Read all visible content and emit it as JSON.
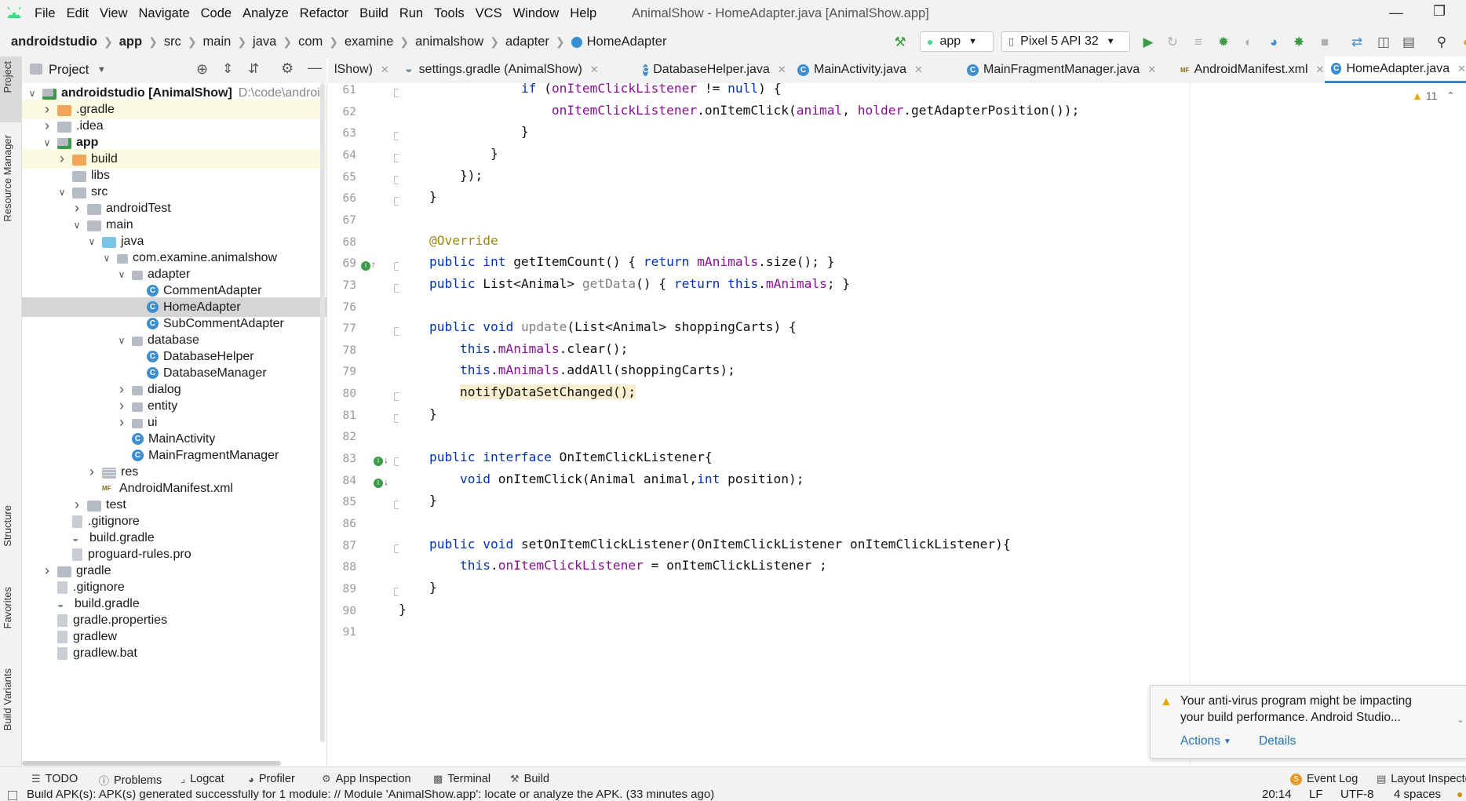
{
  "menubar": {
    "items": [
      "File",
      "Edit",
      "View",
      "Navigate",
      "Code",
      "Analyze",
      "Refactor",
      "Build",
      "Run",
      "Tools",
      "VCS",
      "Window",
      "Help"
    ],
    "window_title": "AnimalShow - HomeAdapter.java [AnimalShow.app]"
  },
  "navbar": {
    "breadcrumbs": [
      "androidstudio",
      "app",
      "src",
      "main",
      "java",
      "com",
      "examine",
      "animalshow",
      "adapter",
      "HomeAdapter"
    ],
    "run_config": "app",
    "device": "Pixel 5 API 32"
  },
  "side_tabs": {
    "left": [
      "Project",
      "Resource Manager",
      "Structure",
      "Favorites",
      "Build Variants"
    ]
  },
  "project_panel": {
    "title": "Project",
    "tree": [
      {
        "label": "androidstudio [AnimalShow]",
        "extra": "D:\\code\\androi",
        "indent": 0,
        "chev": "down",
        "icon": "module-folder",
        "bold": true
      },
      {
        "label": ".gradle",
        "indent": 1,
        "chev": "right",
        "icon": "folder-orange",
        "hl": true
      },
      {
        "label": ".idea",
        "indent": 1,
        "chev": "right",
        "icon": "folder"
      },
      {
        "label": "app",
        "indent": 1,
        "chev": "down",
        "icon": "module-folder",
        "bold": true
      },
      {
        "label": "build",
        "indent": 2,
        "chev": "right",
        "icon": "folder-orange",
        "hl": true
      },
      {
        "label": "libs",
        "indent": 2,
        "chev": "none",
        "icon": "folder"
      },
      {
        "label": "src",
        "indent": 2,
        "chev": "down",
        "icon": "folder"
      },
      {
        "label": "androidTest",
        "indent": 3,
        "chev": "right",
        "icon": "folder"
      },
      {
        "label": "main",
        "indent": 3,
        "chev": "down",
        "icon": "folder"
      },
      {
        "label": "java",
        "indent": 4,
        "chev": "down",
        "icon": "folder-blue"
      },
      {
        "label": "com.examine.animalshow",
        "indent": 5,
        "chev": "down",
        "icon": "package"
      },
      {
        "label": "adapter",
        "indent": 6,
        "chev": "down",
        "icon": "package"
      },
      {
        "label": "CommentAdapter",
        "indent": 7,
        "chev": "none",
        "icon": "class"
      },
      {
        "label": "HomeAdapter",
        "indent": 7,
        "chev": "none",
        "icon": "class",
        "sel": true
      },
      {
        "label": "SubCommentAdapter",
        "indent": 7,
        "chev": "none",
        "icon": "class"
      },
      {
        "label": "database",
        "indent": 6,
        "chev": "down",
        "icon": "package"
      },
      {
        "label": "DatabaseHelper",
        "indent": 7,
        "chev": "none",
        "icon": "class"
      },
      {
        "label": "DatabaseManager",
        "indent": 7,
        "chev": "none",
        "icon": "class"
      },
      {
        "label": "dialog",
        "indent": 6,
        "chev": "right",
        "icon": "package"
      },
      {
        "label": "entity",
        "indent": 6,
        "chev": "right",
        "icon": "package"
      },
      {
        "label": "ui",
        "indent": 6,
        "chev": "right",
        "icon": "package"
      },
      {
        "label": "MainActivity",
        "indent": 6,
        "chev": "none",
        "icon": "class"
      },
      {
        "label": "MainFragmentManager",
        "indent": 6,
        "chev": "none",
        "icon": "class"
      },
      {
        "label": "res",
        "indent": 4,
        "chev": "right",
        "icon": "res-folder"
      },
      {
        "label": "AndroidManifest.xml",
        "indent": 4,
        "chev": "none",
        "icon": "manifest"
      },
      {
        "label": "test",
        "indent": 3,
        "chev": "right",
        "icon": "folder"
      },
      {
        "label": ".gitignore",
        "indent": 2,
        "chev": "none",
        "icon": "file"
      },
      {
        "label": "build.gradle",
        "indent": 2,
        "chev": "none",
        "icon": "gradle"
      },
      {
        "label": "proguard-rules.pro",
        "indent": 2,
        "chev": "none",
        "icon": "file"
      },
      {
        "label": "gradle",
        "indent": 1,
        "chev": "right",
        "icon": "folder"
      },
      {
        "label": ".gitignore",
        "indent": 1,
        "chev": "none",
        "icon": "file"
      },
      {
        "label": "build.gradle",
        "indent": 1,
        "chev": "none",
        "icon": "gradle"
      },
      {
        "label": "gradle.properties",
        "indent": 1,
        "chev": "none",
        "icon": "file"
      },
      {
        "label": "gradlew",
        "indent": 1,
        "chev": "none",
        "icon": "file"
      },
      {
        "label": "gradlew.bat",
        "indent": 1,
        "chev": "none",
        "icon": "file"
      }
    ]
  },
  "editor_tabs": [
    {
      "label": "lShow)",
      "icon": "none",
      "active": false
    },
    {
      "label": "settings.gradle (AnimalShow)",
      "icon": "gradle",
      "active": false
    },
    {
      "label": "DatabaseHelper.java",
      "icon": "class",
      "active": false
    },
    {
      "label": "MainActivity.java",
      "icon": "class",
      "active": false
    },
    {
      "label": "MainFragmentManager.java",
      "icon": "class",
      "active": false
    },
    {
      "label": "AndroidManifest.xml",
      "icon": "manifest",
      "active": false
    },
    {
      "label": "HomeAdapter.java",
      "icon": "class",
      "active": true
    }
  ],
  "inspection": {
    "count": "11"
  },
  "code_lines": [
    {
      "n": "61",
      "tokens": [
        [
          "            ",
          ""
        ],
        [
          "if",
          "kw"
        ],
        [
          " (",
          ""
        ],
        [
          "onItemClickListener",
          "fld"
        ],
        [
          " != ",
          ""
        ],
        [
          "null",
          "kw"
        ],
        [
          ") {",
          ""
        ]
      ]
    },
    {
      "n": "62",
      "tokens": [
        [
          "                ",
          ""
        ],
        [
          "onItemClickListener",
          "fld"
        ],
        [
          ".onItemClick(",
          ""
        ],
        [
          "animal",
          "fld"
        ],
        [
          ", ",
          ""
        ],
        [
          "holder",
          "fld"
        ],
        [
          ".getAdapterPosition());",
          ""
        ]
      ]
    },
    {
      "n": "63",
      "tokens": [
        [
          "            }",
          ""
        ]
      ]
    },
    {
      "n": "64",
      "tokens": [
        [
          "        }",
          ""
        ]
      ]
    },
    {
      "n": "65",
      "tokens": [
        [
          "    });",
          ""
        ]
      ]
    },
    {
      "n": "66",
      "tokens": [
        [
          "}",
          ""
        ]
      ]
    },
    {
      "n": "67",
      "tokens": []
    },
    {
      "n": "68",
      "tokens": [
        [
          "@Override",
          "ann"
        ]
      ]
    },
    {
      "n": "69",
      "tokens": [
        [
          "public int ",
          "kw"
        ],
        [
          "getItemCount() { ",
          ""
        ],
        [
          "return ",
          "kw"
        ],
        [
          "mAnimals",
          "fld"
        ],
        [
          ".size(); }",
          ""
        ]
      ]
    },
    {
      "n": "73",
      "tokens": [
        [
          "public ",
          "kw"
        ],
        [
          "List<Animal> ",
          ""
        ],
        [
          "getData",
          "gray"
        ],
        [
          "() { ",
          ""
        ],
        [
          "return this",
          "kw"
        ],
        [
          ".",
          ""
        ],
        [
          "mAnimals",
          "fld"
        ],
        [
          "; }",
          ""
        ]
      ]
    },
    {
      "n": "76",
      "tokens": []
    },
    {
      "n": "77",
      "tokens": [
        [
          "public void ",
          "kw"
        ],
        [
          "update",
          "gray"
        ],
        [
          "(List<Animal> shoppingCarts) {",
          ""
        ]
      ]
    },
    {
      "n": "78",
      "tokens": [
        [
          "    ",
          ""
        ],
        [
          "this",
          "kw"
        ],
        [
          ".",
          ""
        ],
        [
          "mAnimals",
          "fld"
        ],
        [
          ".clear();",
          ""
        ]
      ]
    },
    {
      "n": "79",
      "tokens": [
        [
          "    ",
          ""
        ],
        [
          "this",
          "kw"
        ],
        [
          ".",
          ""
        ],
        [
          "mAnimals",
          "fld"
        ],
        [
          ".addAll(shoppingCarts);",
          ""
        ]
      ]
    },
    {
      "n": "80",
      "tokens": [
        [
          "    ",
          ""
        ],
        [
          "notifyDataSetChanged();",
          "hlwarn"
        ]
      ]
    },
    {
      "n": "81",
      "tokens": [
        [
          "}",
          ""
        ]
      ]
    },
    {
      "n": "82",
      "tokens": []
    },
    {
      "n": "83",
      "tokens": [
        [
          "public interface ",
          "kw"
        ],
        [
          "OnItemClickListener{",
          ""
        ]
      ]
    },
    {
      "n": "84",
      "tokens": [
        [
          "    ",
          ""
        ],
        [
          "void ",
          "kw"
        ],
        [
          "onItemClick(Animal animal,",
          ""
        ],
        [
          "int ",
          "kw"
        ],
        [
          "position);",
          ""
        ]
      ]
    },
    {
      "n": "85",
      "tokens": [
        [
          "}",
          ""
        ]
      ]
    },
    {
      "n": "86",
      "tokens": []
    },
    {
      "n": "87",
      "tokens": [
        [
          "public void ",
          "kw"
        ],
        [
          "setOnItemClickListener(OnItemClickListener onItemClickListener){",
          ""
        ]
      ]
    },
    {
      "n": "88",
      "tokens": [
        [
          "    ",
          ""
        ],
        [
          "this",
          "kw"
        ],
        [
          ".",
          ""
        ],
        [
          "onItemClickListener",
          "fld"
        ],
        [
          " = onItemClickListener ;",
          ""
        ]
      ]
    },
    {
      "n": "89",
      "tokens": [
        [
          "}",
          ""
        ]
      ]
    },
    {
      "n": "90",
      "tokens": [
        [
          "}",
          ""
        ]
      ]
    },
    {
      "n": "91",
      "tokens": []
    }
  ],
  "notification": {
    "text_line1": "Your anti-virus program might be impacting",
    "text_line2": "your build performance. Android Studio...",
    "actions_label": "Actions",
    "details_label": "Details"
  },
  "bottom_tools": {
    "todo": "TODO",
    "problems": "Problems",
    "logcat": "Logcat",
    "profiler": "Profiler",
    "app_inspection": "App Inspection",
    "terminal": "Terminal",
    "build": "Build",
    "event_log": "Event Log",
    "event_log_count": "5",
    "layout_inspector": "Layout Inspecto"
  },
  "statusbar": {
    "message": "Build APK(s): APK(s) generated successfully for 1 module: // Module 'AnimalShow.app': locate or analyze the APK. (33 minutes ago)",
    "position": "20:14",
    "line_sep": "LF",
    "encoding": "UTF-8",
    "indent": "4 spaces"
  },
  "colors": {
    "accent": "#4083c9",
    "keyword": "#0033b3",
    "field": "#871094",
    "annotation": "#9e880d",
    "run_green": "#3b9b47"
  }
}
